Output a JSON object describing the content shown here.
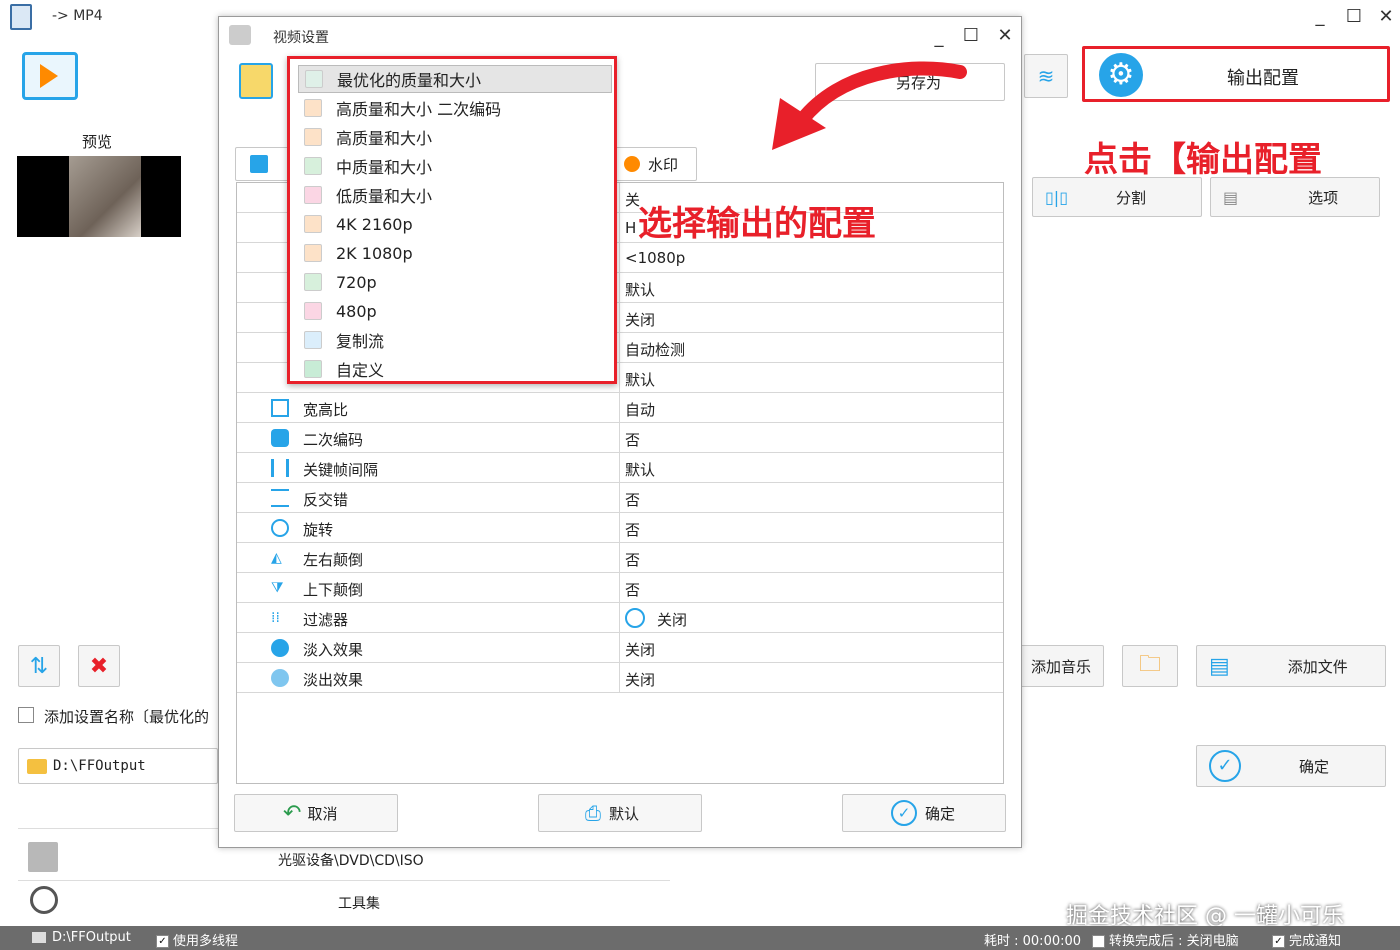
{
  "main_window": {
    "title": "-> MP4",
    "preview_label": "预览",
    "add_setting_name": "添加设置名称〔最优化的",
    "output_folder": "D:\\FFOutput",
    "bottom_list": [
      "光驱设备\\DVD\\CD\\ISO",
      "工具集"
    ],
    "buttons": {
      "output_config": "输出配置",
      "split": "分割",
      "options": "选项",
      "add_music": "添加音乐",
      "add_file": "添加文件",
      "ok": "确定"
    }
  },
  "annotations": {
    "click_output_config": "点击【输出配置",
    "select_output_config": "选择输出的配置",
    "watermark": "掘金技术社区 @ 一罐小可乐"
  },
  "dialog": {
    "title": "视频设置",
    "save_as": "另存为",
    "watermark_tab": "水印",
    "buttons": {
      "cancel": "取消",
      "default": "默认",
      "ok": "确定"
    },
    "preset_options": [
      "最优化的质量和大小",
      "高质量和大小 二次编码",
      "高质量和大小",
      "中质量和大小",
      "低质量和大小",
      "4K 2160p",
      "2K 1080p",
      "720p",
      "480p",
      "复制流",
      "自定义"
    ],
    "hidden_values": [
      "关",
      "H",
      "<1080p",
      "默认",
      "关闭",
      "自动检测",
      "默认"
    ],
    "settings": [
      {
        "key": "宽高比",
        "value": "自动"
      },
      {
        "key": "二次编码",
        "value": "否"
      },
      {
        "key": "关键帧间隔",
        "value": "默认"
      },
      {
        "key": "反交错",
        "value": "否"
      },
      {
        "key": "旋转",
        "value": "否"
      },
      {
        "key": "左右颠倒",
        "value": "否"
      },
      {
        "key": "上下颠倒",
        "value": "否"
      },
      {
        "key": "过滤器",
        "value": "关闭"
      },
      {
        "key": "淡入效果",
        "value": "关闭"
      },
      {
        "key": "淡出效果",
        "value": "关闭"
      }
    ]
  },
  "status_bar": {
    "output_path": "D:\\FFOutput",
    "multithread": "使用多线程",
    "elapsed": "耗时 : 00:00:00",
    "after_convert": "转换完成后 : 关闭电脑",
    "notify": "完成通知"
  }
}
